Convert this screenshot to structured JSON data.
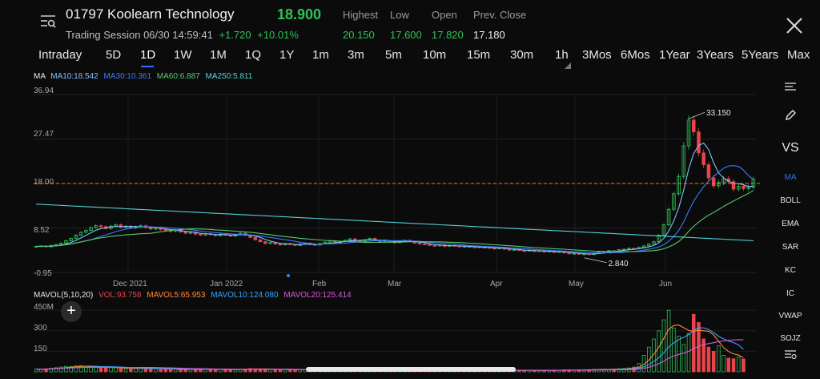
{
  "header": {
    "name": "01797 Koolearn Technology",
    "price": "18.900",
    "session": "Trading Session 06/30 14:59:41",
    "change": "+1.720",
    "change_pct": "+10.01%",
    "labels": {
      "highest": "Highest",
      "low": "Low",
      "open": "Open",
      "prev_close": "Prev. Close"
    },
    "values": {
      "highest": "20.150",
      "low": "17.600",
      "open": "17.820",
      "prev_close": "17.180"
    }
  },
  "tabs": [
    {
      "label": "Intraday"
    },
    {
      "label": "5D"
    },
    {
      "label": "1D"
    },
    {
      "label": "1W"
    },
    {
      "label": "1M"
    },
    {
      "label": "1Q"
    },
    {
      "label": "1Y"
    },
    {
      "label": "1m"
    },
    {
      "label": "3m"
    },
    {
      "label": "5m"
    },
    {
      "label": "10m"
    },
    {
      "label": "15m"
    },
    {
      "label": "30m"
    },
    {
      "label": "1h"
    },
    {
      "label": "3Mos"
    },
    {
      "label": "6Mos"
    },
    {
      "label": "1Year"
    },
    {
      "label": "3Years"
    },
    {
      "label": "5Years"
    },
    {
      "label": "Max"
    }
  ],
  "active_tab": "1D",
  "ma_legend": {
    "title": "MA",
    "ma10": "MA10:18.542",
    "ma30": "MA30:10.361",
    "ma60": "MA60:6.887",
    "ma250": "MA250:5.811"
  },
  "vol_legend": {
    "title": "MAVOL(5,10,20)",
    "vol": "VOL:93.758",
    "mavol5": "MAVOL5:65.953",
    "mavol10": "MAVOL10:124.080",
    "mavol20": "MAVOL20:125.414"
  },
  "sidebar": {
    "vs": "VS",
    "items": [
      "MA",
      "BOLL",
      "EMA",
      "SAR",
      "KC",
      "IC",
      "VWAP",
      "SOJZ"
    ]
  },
  "colors": {
    "up": "#2ec25a",
    "down": "#e8444a",
    "ma10": "#7ec3ff",
    "ma30": "#3a7bff",
    "ma60": "#55c96a",
    "ma250": "#4fd1d9",
    "mavol5": "#ff8a3d",
    "mavol10": "#3aa3ff",
    "mavol20": "#d65ad8",
    "accent": "#2d73ff",
    "prev_close_line": "#ff7a2a"
  },
  "chart_data": {
    "type": "candlestick",
    "y_ticks": [
      "36.94",
      "27.47",
      "18.00",
      "8.52",
      "-0.95"
    ],
    "ylim": [
      -0.95,
      36.94
    ],
    "x_labels": [
      "Dec 2021",
      "Jan 2022",
      "Feb",
      "Mar",
      "Apr",
      "May",
      "Jun"
    ],
    "max_label": "33.150",
    "min_label": "2.840",
    "max_value": 33.15,
    "min_value": 2.84,
    "reference_line": 18.0,
    "close": [
      4.6,
      4.7,
      4.5,
      4.8,
      5.0,
      5.3,
      5.8,
      6.3,
      7.0,
      7.6,
      8.0,
      8.6,
      9.0,
      8.8,
      8.4,
      8.9,
      9.2,
      8.7,
      8.9,
      8.5,
      8.8,
      9.0,
      8.6,
      8.3,
      8.5,
      8.2,
      8.0,
      7.8,
      8.1,
      7.7,
      7.4,
      7.6,
      7.2,
      7.0,
      7.3,
      7.1,
      6.9,
      7.2,
      7.0,
      6.8,
      7.1,
      7.4,
      7.0,
      6.5,
      6.0,
      5.6,
      5.2,
      5.4,
      5.1,
      4.9,
      5.2,
      5.0,
      4.8,
      5.1,
      5.3,
      5.0,
      4.9,
      5.2,
      5.5,
      5.8,
      5.4,
      5.6,
      5.9,
      6.2,
      5.9,
      5.7,
      6.0,
      6.3,
      5.9,
      5.6,
      5.8,
      5.5,
      5.4,
      5.7,
      5.9,
      5.6,
      5.3,
      5.1,
      5.0,
      4.8,
      4.7,
      4.9,
      4.6,
      4.8,
      4.7,
      4.5,
      4.6,
      4.4,
      4.5,
      4.3,
      4.4,
      4.2,
      4.1,
      4.3,
      4.0,
      3.8,
      3.9,
      3.7,
      3.6,
      3.8,
      3.5,
      3.7,
      3.4,
      3.6,
      3.3,
      3.5,
      3.2,
      3.0,
      3.1,
      2.9,
      3.0,
      2.84,
      3.2,
      3.4,
      3.5,
      3.7,
      3.6,
      3.9,
      4.0,
      4.2,
      4.1,
      4.4,
      4.7,
      5.1,
      5.6,
      7.0,
      9.2,
      12.5,
      15.8,
      19.5,
      26.0,
      31.5,
      29.0,
      24.5,
      22.0,
      19.2,
      17.5,
      18.2,
      19.0,
      18.4,
      16.8,
      17.4,
      16.9,
      17.2,
      18.9
    ],
    "volume": [
      20,
      18,
      22,
      25,
      30,
      35,
      40,
      38,
      42,
      45,
      40,
      38,
      35,
      30,
      28,
      32,
      30,
      26,
      24,
      22,
      25,
      28,
      24,
      20,
      22,
      20,
      18,
      21,
      19,
      17,
      16,
      18,
      20,
      22,
      19,
      17,
      16,
      18,
      15,
      14,
      16,
      18,
      20,
      24,
      22,
      20,
      18,
      17,
      16,
      15,
      17,
      16,
      15,
      16,
      18,
      17,
      16,
      18,
      20,
      22,
      19,
      17,
      18,
      20,
      18,
      16,
      17,
      19,
      18,
      17,
      16,
      15,
      14,
      16,
      17,
      15,
      14,
      13,
      12,
      14,
      13,
      12,
      14,
      13,
      12,
      11,
      12,
      13,
      11,
      10,
      12,
      11,
      10,
      12,
      11,
      10,
      12,
      11,
      10,
      12,
      11,
      10,
      12,
      11,
      13,
      12,
      14,
      13,
      12,
      14,
      15,
      16,
      18,
      17,
      19,
      18,
      20,
      22,
      24,
      28,
      35,
      60,
      120,
      180,
      240,
      300,
      380,
      450,
      320,
      260,
      200,
      280,
      420,
      360,
      240,
      180,
      150,
      190,
      120,
      100,
      95,
      110,
      94
    ]
  }
}
